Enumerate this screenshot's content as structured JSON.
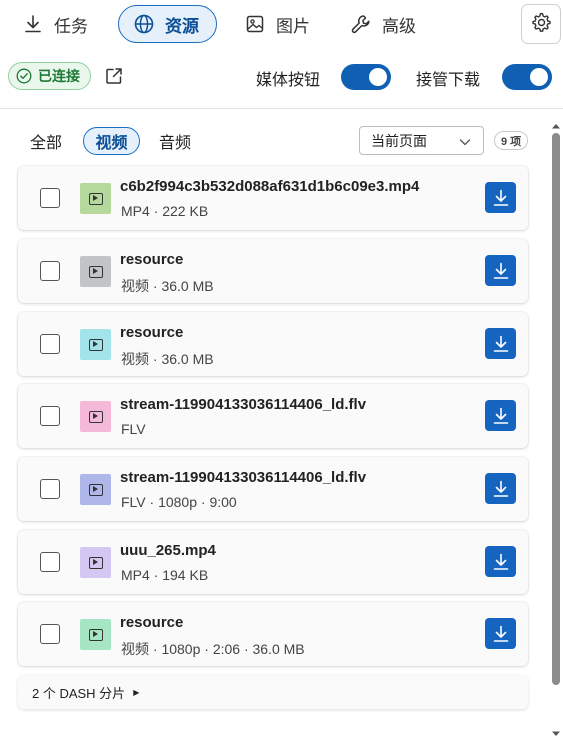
{
  "nav": {
    "tabs": [
      {
        "label": "任务",
        "icon": "download-icon"
      },
      {
        "label": "资源",
        "icon": "globe-icon",
        "active": true
      },
      {
        "label": "图片",
        "icon": "image-icon"
      },
      {
        "label": "高级",
        "icon": "wrench-icon"
      }
    ],
    "settings_icon": "gear-icon"
  },
  "status": {
    "connected_label": "已连接",
    "color": "#1e7a34"
  },
  "toggles": {
    "media_button": {
      "label": "媒体按钮",
      "on": true
    },
    "takeover_download": {
      "label": "接管下载",
      "on": true
    }
  },
  "filters": {
    "tabs": [
      {
        "label": "全部"
      },
      {
        "label": "视频",
        "active": true
      },
      {
        "label": "音频"
      }
    ],
    "scope_select": "当前页面",
    "count_badge": "9 项"
  },
  "items": [
    {
      "name": "c6b2f994c3b532d088af631d1b6c09e3.mp4",
      "meta": "MP4 · 222 KB",
      "thumb_color": "#b5d99c"
    },
    {
      "name": "resource",
      "meta": "视频 · 36.0 MB",
      "thumb_color": "#c2c4c6"
    },
    {
      "name": "resource",
      "meta": "视频 · 36.0 MB",
      "thumb_color": "#a3e4ea"
    },
    {
      "name": "stream-119904133036114406_ld.flv",
      "meta": "FLV",
      "thumb_color": "#f4b8d9"
    },
    {
      "name": "stream-119904133036114406_ld.flv",
      "meta": "FLV · 1080p · 9:00",
      "thumb_color": "#aeb6ea"
    },
    {
      "name": "uuu_265.mp4",
      "meta": "MP4 · 194 KB",
      "thumb_color": "#d4c8f2"
    },
    {
      "name": "resource",
      "meta": "视频 · 1080p · 2:06 · 36.0 MB",
      "thumb_color": "#a6e6c4"
    }
  ],
  "dash_segments": "2 个 DASH 分片",
  "colors": {
    "accent": "#1565c0",
    "active_tab_bg": "#e6f0fb"
  }
}
